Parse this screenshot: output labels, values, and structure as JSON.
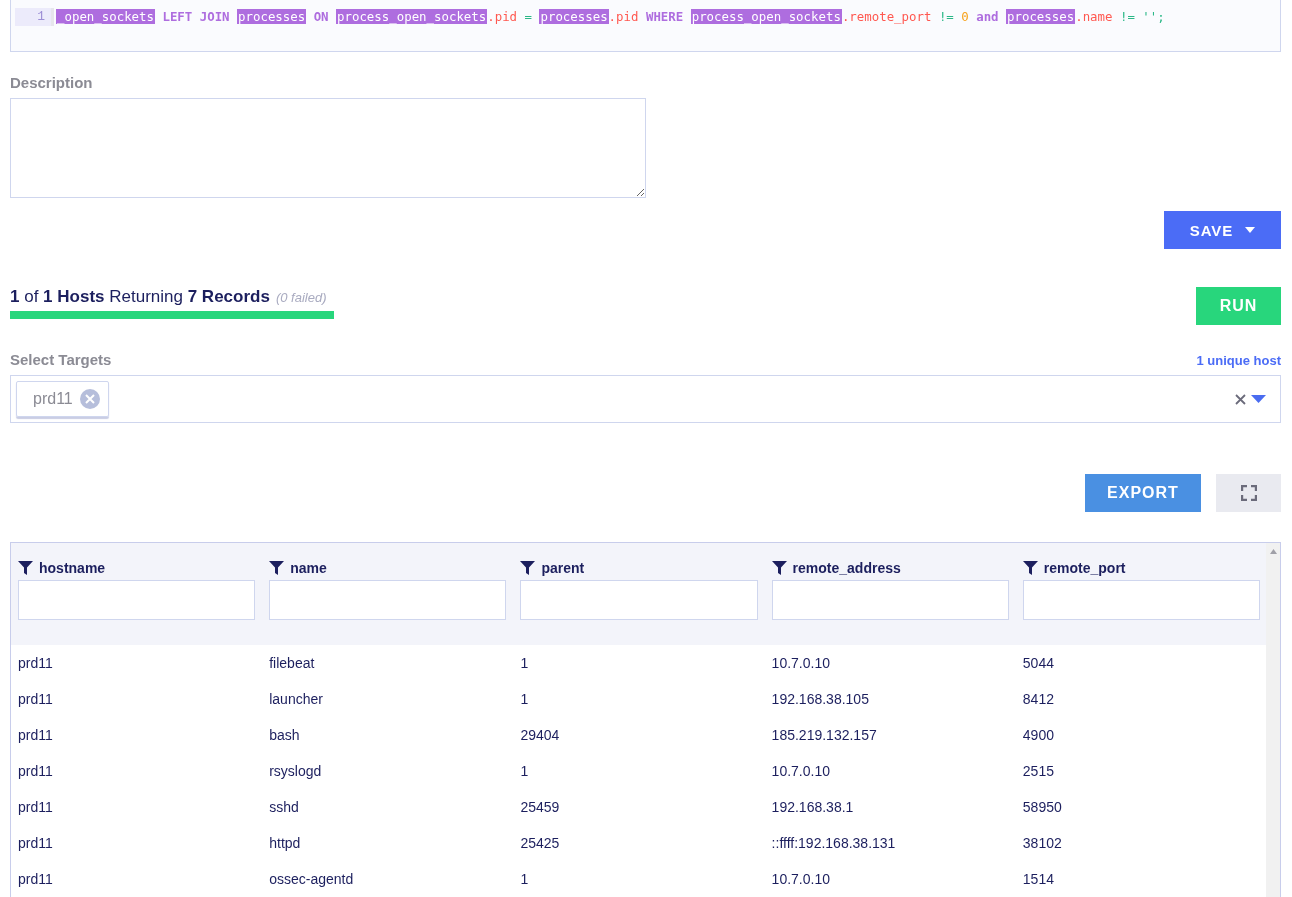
{
  "editor": {
    "line_number": "1",
    "tokens": [
      {
        "kind": "table",
        "text": "_open_sockets"
      },
      {
        "kind": "keyword",
        "text": " LEFT JOIN "
      },
      {
        "kind": "table",
        "text": "processes"
      },
      {
        "kind": "keyword",
        "text": " ON "
      },
      {
        "kind": "table",
        "text": "process_open_sockets"
      },
      {
        "kind": "field",
        "text": ".pid "
      },
      {
        "kind": "operator",
        "text": "= "
      },
      {
        "kind": "table",
        "text": "processes"
      },
      {
        "kind": "field",
        "text": ".pid "
      },
      {
        "kind": "keyword",
        "text": "WHERE "
      },
      {
        "kind": "table",
        "text": "process_open_sockets"
      },
      {
        "kind": "field",
        "text": ".remote_port "
      },
      {
        "kind": "operator",
        "text": "!= "
      },
      {
        "kind": "number",
        "text": "0 "
      },
      {
        "kind": "keyword",
        "text": "and "
      },
      {
        "kind": "table",
        "text": "processes"
      },
      {
        "kind": "field",
        "text": ".name "
      },
      {
        "kind": "operator",
        "text": "!= "
      },
      {
        "kind": "string",
        "text": "'';"
      }
    ]
  },
  "description": {
    "label": "Description"
  },
  "save_button": {
    "label": "SAVE"
  },
  "status": {
    "summary": "**1** of **1 Hosts** Returning **7 Records**",
    "failed_note": "(0 failed)",
    "progress": {
      "level": 1
    }
  },
  "run_button": {
    "label": "RUN"
  },
  "targets": {
    "label": "Select Targets",
    "host_count_link": "1 unique host",
    "chips": [
      "prd11"
    ]
  },
  "export_button": {
    "label": "EXPORT"
  },
  "table": {
    "columns": [
      "hostname",
      "name",
      "parent",
      "remote_address",
      "remote_port"
    ],
    "rows": [
      [
        "prd11",
        "filebeat",
        "1",
        "10.7.0.10",
        "5044"
      ],
      [
        "prd11",
        "launcher",
        "1",
        "192.168.38.105",
        "8412"
      ],
      [
        "prd11",
        "bash",
        "29404",
        "185.219.132.157",
        "4900"
      ],
      [
        "prd11",
        "rsyslogd",
        "1",
        "10.7.0.10",
        "2515"
      ],
      [
        "prd11",
        "sshd",
        "25459",
        "192.168.38.1",
        "58950"
      ],
      [
        "prd11",
        "httpd",
        "25425",
        "::ffff:192.168.38.131",
        "38102"
      ],
      [
        "prd11",
        "ossec-agentd",
        "1",
        "10.7.0.10",
        "1514"
      ]
    ]
  }
}
